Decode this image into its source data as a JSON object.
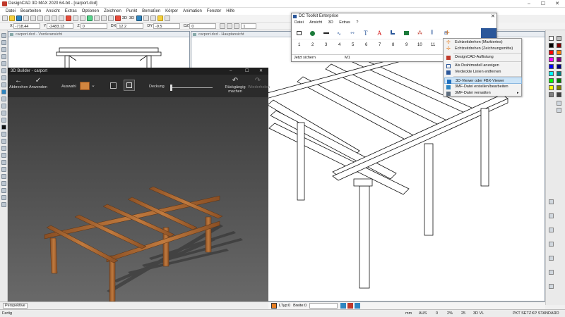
{
  "window": {
    "title": "DesignCAD 3D MAX 2020 64-bit - [carport.dcd]"
  },
  "menu": [
    "Datei",
    "Bearbeiten",
    "Ansicht",
    "Extras",
    "Optionen",
    "Zeichnen",
    "Punkt",
    "Bemaßen",
    "Körper",
    "Animation",
    "Fenster",
    "Hilfe"
  ],
  "coords": {
    "x_label": "X",
    "x_value": "-718.44",
    "y_label": "Y",
    "y_value": "-2483.13",
    "z_label": "Z",
    "z_value": "0",
    "dx_label": "DX",
    "dx_value": "12.2",
    "dy_label": "DY",
    "dy_value": "-9.5",
    "dz_label": "DZ",
    "dz_value": "0",
    "step_value": "1"
  },
  "toolbar": {
    "label_2d": "2D",
    "label_3d": "3D"
  },
  "views": {
    "front": "carport.dcd - Vorderansicht",
    "main": "carport.dcd - Hauptansicht"
  },
  "builder": {
    "title": "3D Builder - carport",
    "back": "Abbrechen",
    "apply": "Anwenden",
    "selection": "Auswahl",
    "coverage": "Deckung",
    "undo": "Rückgängig machen",
    "redo": "Wiederholen"
  },
  "toolkit": {
    "title": "DC Toolkit Enterprise",
    "menu": [
      "Datei",
      "Ansicht",
      "3D",
      "Extras",
      "?"
    ],
    "numbers": [
      "1",
      "2",
      "3",
      "4",
      "5",
      "6",
      "7",
      "8",
      "9",
      "10",
      "11"
    ],
    "status_left": "Jetzt sichern",
    "status_mid": "M1"
  },
  "context_menu": {
    "items": [
      "Echtzeitdrehen (Markiertes)",
      "Echtzeitdrehen (Zeichnungsmitte)",
      "DesignCAD-Auflistung",
      "Als Drahtmodell anzeigen",
      "Verdeckte Linien entfernen",
      "3D-Viewer oder FBX-Viewer",
      "3MF-Datei erstellen/bearbeiten",
      "3MF-Datei verwalten"
    ]
  },
  "bottom": {
    "perspective": "Perspektive",
    "ltyp": "LTyp:0",
    "breite": "Breite:0"
  },
  "status": {
    "ready": "Fertig",
    "unit": "mm",
    "aus": "AUS",
    "zero": "0",
    "pct": "2%",
    "value": "25",
    "mode": "3D VL",
    "pkt": "PKT SETZ",
    "kp": "KP STANDARD"
  },
  "colors": {
    "accent_blue": "#2b579a",
    "wood": "#b46a34",
    "builder_bg": "#4c4c4c"
  }
}
